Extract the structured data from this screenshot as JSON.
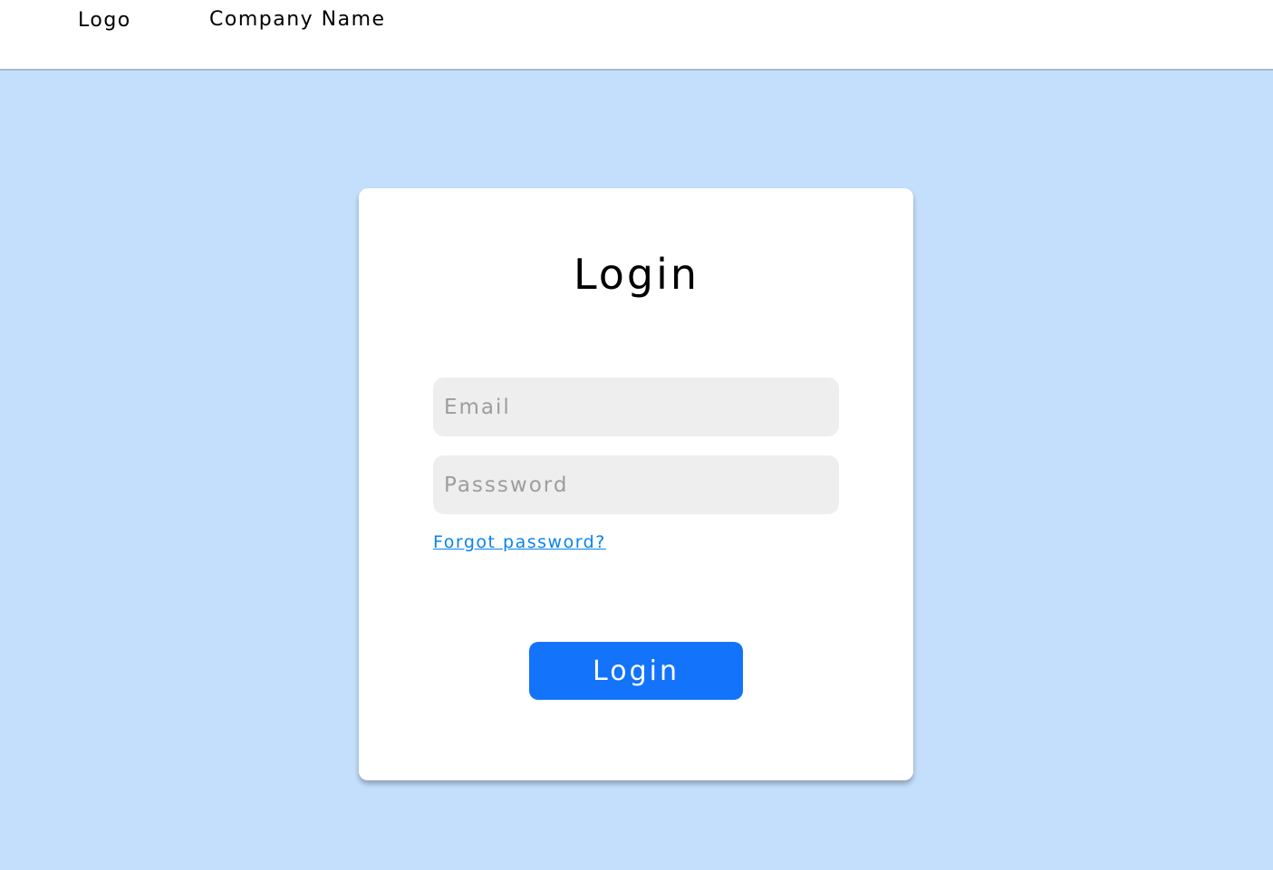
{
  "header": {
    "logo_text": "Logo",
    "company_name": "Company Name"
  },
  "login_card": {
    "title": "Login",
    "email": {
      "value": "",
      "placeholder": "Email"
    },
    "password": {
      "value": "",
      "placeholder": "Passsword"
    },
    "forgot_password_link": "Forgot password?",
    "submit_label": "Login"
  },
  "colors": {
    "page_background": "#c4dffc",
    "header_background": "#ffffff",
    "card_background": "#ffffff",
    "input_background": "#eeeeee",
    "link": "#0a83ec",
    "primary_button": "#1373fb"
  }
}
